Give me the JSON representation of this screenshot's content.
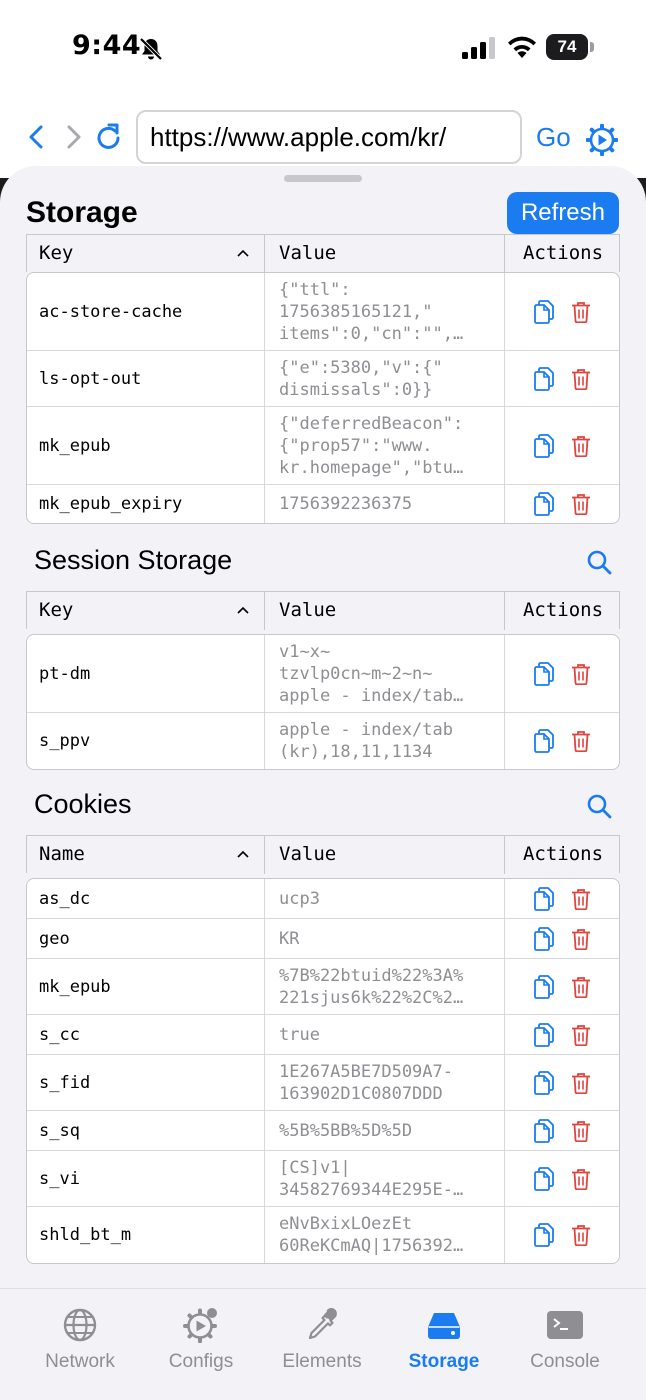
{
  "status": {
    "time": "9:44",
    "battery": "74"
  },
  "browser": {
    "url": "https://www.apple.com/kr/",
    "go_label": "Go"
  },
  "storage": {
    "title": "Storage",
    "refresh_label": "Refresh",
    "columns": {
      "key": "Key",
      "value": "Value",
      "actions": "Actions"
    },
    "rows": [
      {
        "key": "ac-store-cache",
        "value": "{\"ttl\":\n1756385165121,\"\nitems\":0,\"cn\":\"\",…"
      },
      {
        "key": "ls-opt-out",
        "value": "{\"e\":5380,\"v\":{\"\ndismissals\":0}}"
      },
      {
        "key": "mk_epub",
        "value": "{\"deferredBeacon\":\n{\"prop57\":\"www.\nkr.homepage\",\"btu…"
      },
      {
        "key": "mk_epub_expiry",
        "value": "1756392236375"
      }
    ]
  },
  "session": {
    "title": "Session Storage",
    "columns": {
      "key": "Key",
      "value": "Value",
      "actions": "Actions"
    },
    "rows": [
      {
        "key": "pt-dm",
        "value": "v1~x~\ntzvlp0cn~m~2~n~\napple - index/tab…"
      },
      {
        "key": "s_ppv",
        "value": "apple - index/tab\n(kr),18,11,1134"
      }
    ]
  },
  "cookies": {
    "title": "Cookies",
    "columns": {
      "key": "Name",
      "value": "Value",
      "actions": "Actions"
    },
    "rows": [
      {
        "key": "as_dc",
        "value": "ucp3"
      },
      {
        "key": "geo",
        "value": "KR"
      },
      {
        "key": "mk_epub",
        "value": "%7B%22btuid%22%3A%\n221sjus6k%22%2C%2…"
      },
      {
        "key": "s_cc",
        "value": "true"
      },
      {
        "key": "s_fid",
        "value": "1E267A5BE7D509A7-\n163902D1C0807DDD"
      },
      {
        "key": "s_sq",
        "value": "%5B%5BB%5D%5D"
      },
      {
        "key": "s_vi",
        "value": "[CS]v1|\n34582769344E295E-…"
      },
      {
        "key": "shld_bt_m",
        "value": "eNvBxixLOezEt\n60ReKCmAQ|1756392…"
      }
    ]
  },
  "tabs": [
    {
      "label": "Network",
      "icon": "globe-icon"
    },
    {
      "label": "Configs",
      "icon": "configs-gear-icon"
    },
    {
      "label": "Elements",
      "icon": "eyedropper-icon"
    },
    {
      "label": "Storage",
      "icon": "storage-drive-icon",
      "active": true
    },
    {
      "label": "Console",
      "icon": "terminal-icon"
    }
  ],
  "colors": {
    "accent": "#1a7cf0",
    "danger": "#e0443c",
    "muted": "#8e8e93"
  }
}
